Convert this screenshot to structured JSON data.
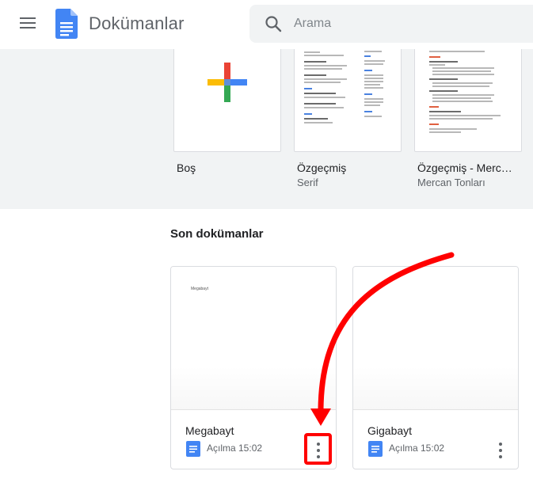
{
  "header": {
    "app_title": "Dokümanlar",
    "search_placeholder": "Arama",
    "logo_color": "#4285f4"
  },
  "templates": [
    {
      "name": "Boş",
      "subtitle": ""
    },
    {
      "name": "Özgeçmiş",
      "subtitle": "Serif"
    },
    {
      "name": "Özgeçmiş - Merc…",
      "subtitle": "Mercan Tonları"
    }
  ],
  "recent": {
    "title": "Son dokümanlar",
    "docs": [
      {
        "title": "Megabayt",
        "meta": "Açılma 15:02",
        "preview_text": "Megabayt"
      },
      {
        "title": "Gigabayt",
        "meta": "Açılma 15:02",
        "preview_text": ""
      }
    ]
  },
  "colors": {
    "annotation": "#ff0000",
    "band": "#f1f3f4"
  },
  "icons": [
    "menu-icon",
    "docs-logo-icon",
    "search-icon",
    "plus-icon",
    "doc-type-icon",
    "more-vert-icon"
  ]
}
